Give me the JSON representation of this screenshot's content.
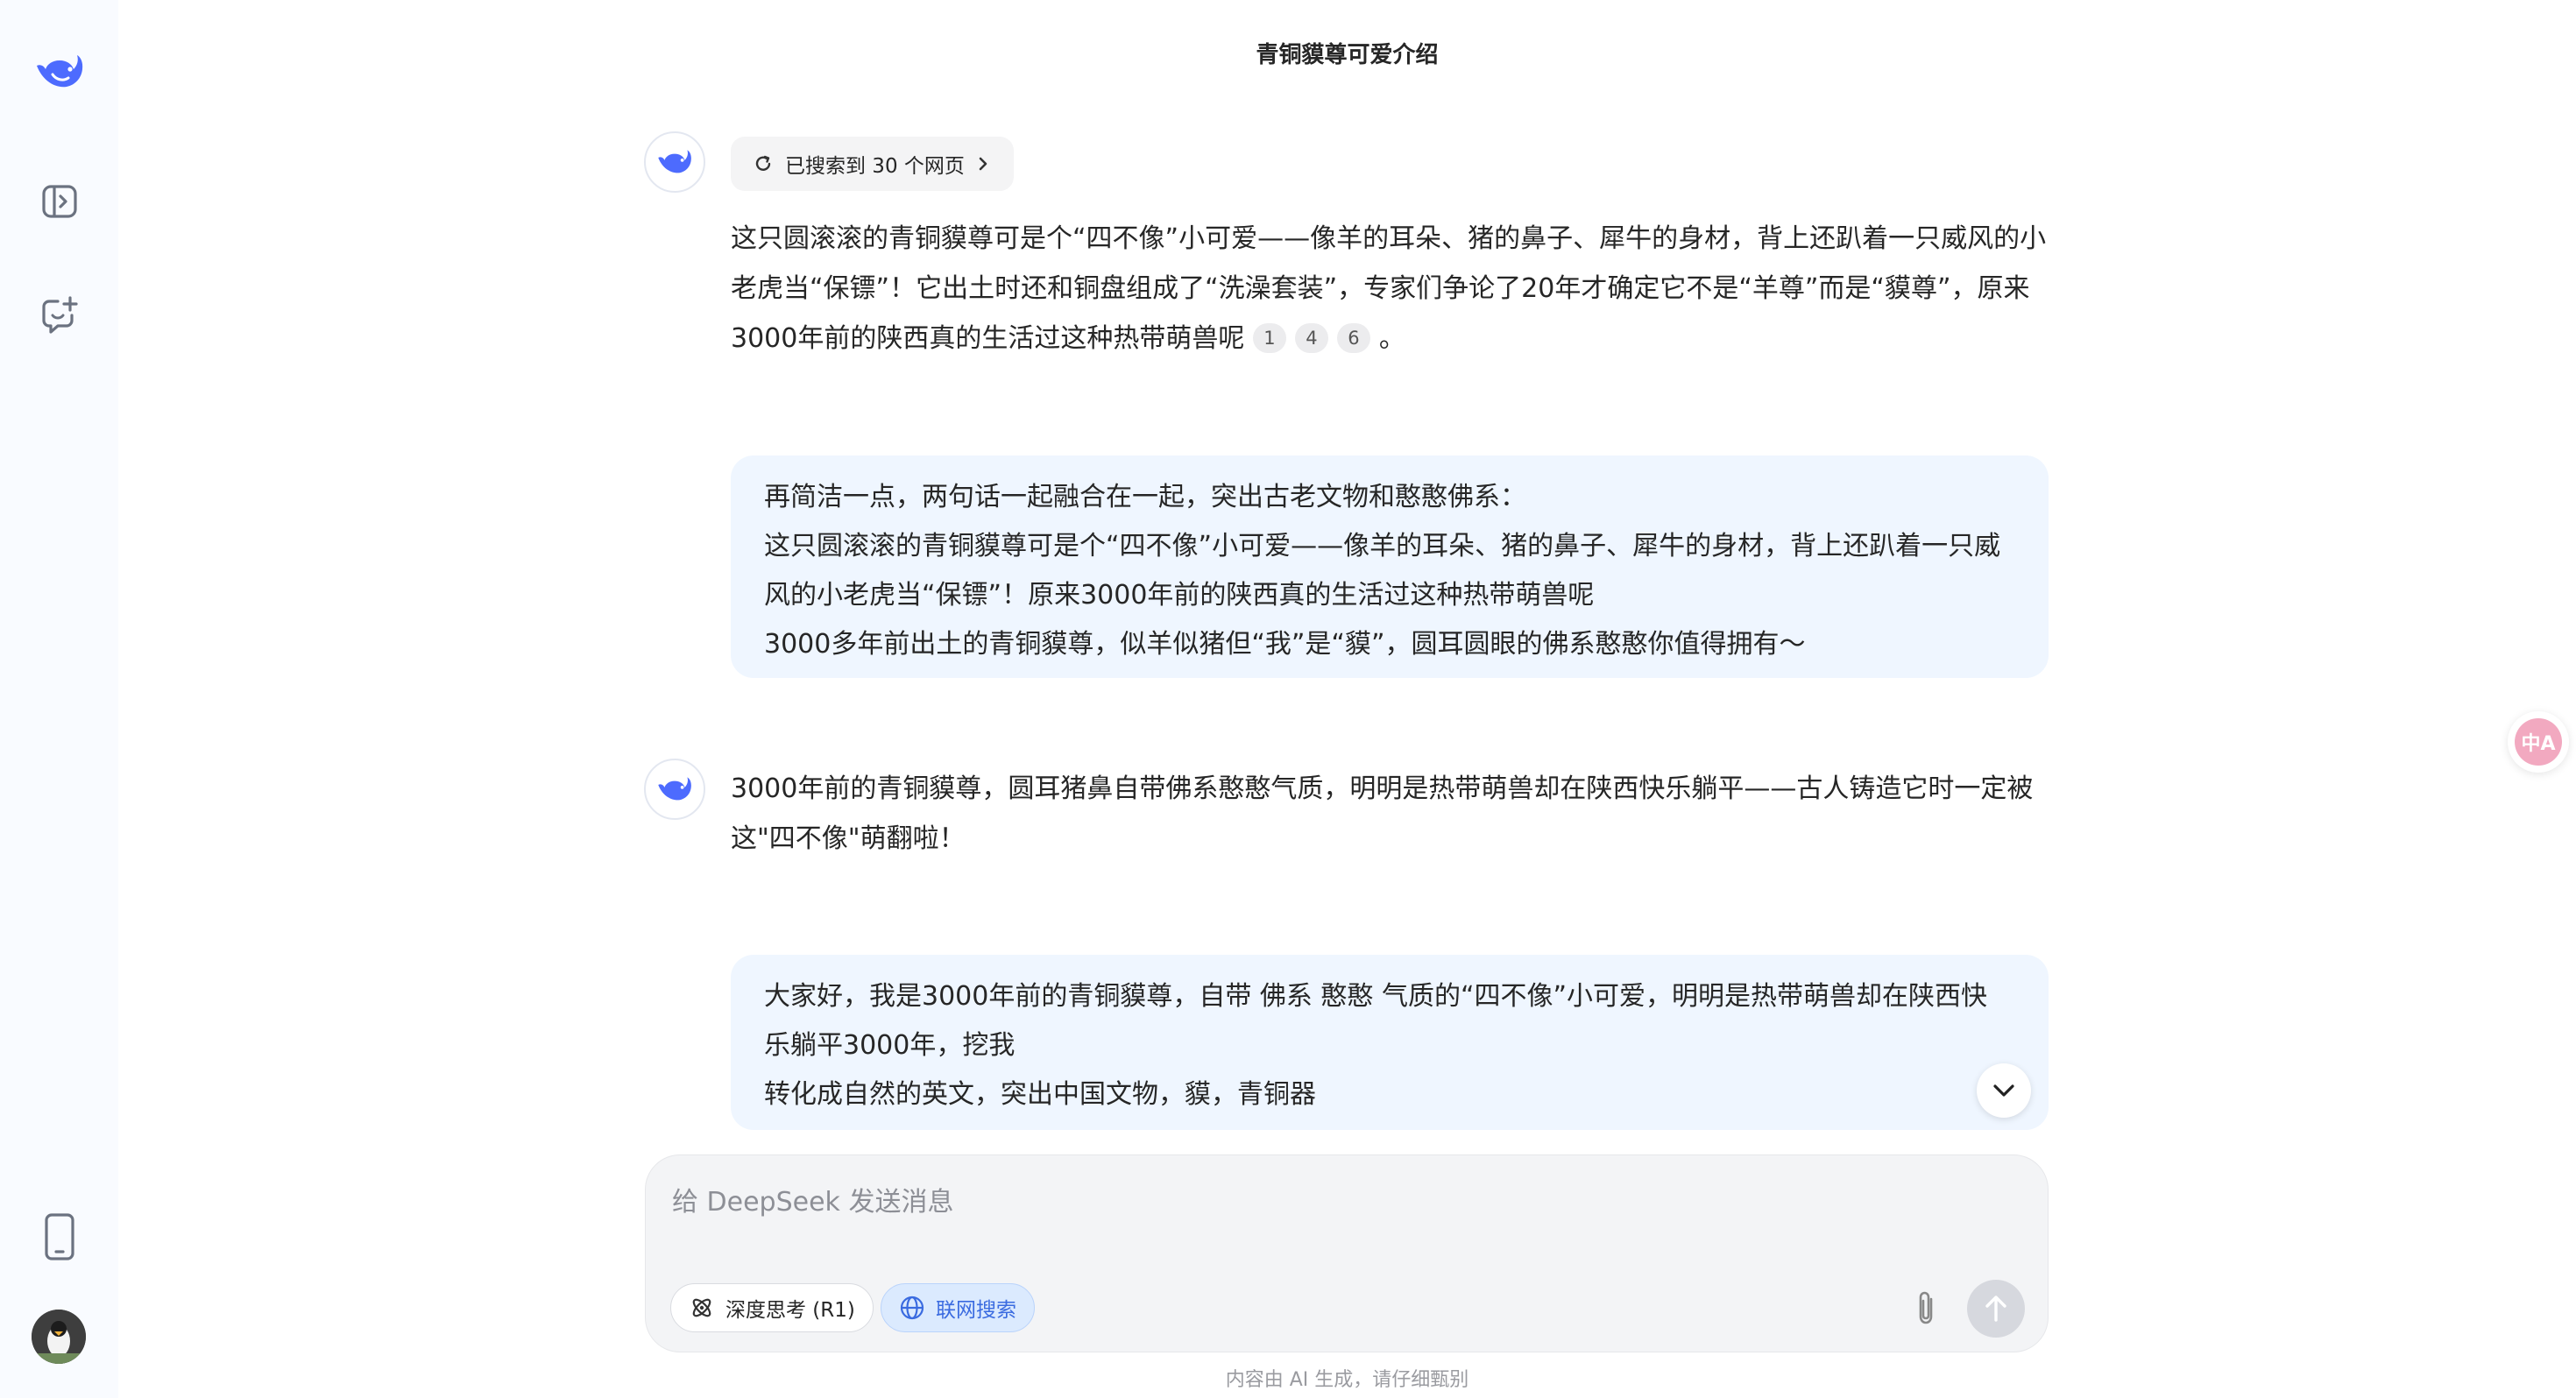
{
  "header": {
    "title": "青铜貘尊可爱介绍"
  },
  "search": {
    "label": "已搜索到 30 个网页"
  },
  "messages": {
    "a1": {
      "line1": "这只圆滚滚的青铜貘尊可是个“四不像”小可爱——像羊的耳朵、猪的鼻子、犀牛的身材，背上还趴着一只威风的小",
      "line2": "老虎当“保镖”！它出土时还和铜盘组成了“洗澡套装”，专家们争论了20年才确定它不是“羊尊”而是“貘尊”，原来",
      "line3": "3000年前的陕西真的生活过这种热带萌兽呢",
      "citations": [
        "1",
        "4",
        "6"
      ],
      "end": "。"
    },
    "u1": {
      "line1": "再简洁一点，两句话一起融合在一起，突出古老文物和憨憨佛系：",
      "line2": "这只圆滚滚的青铜貘尊可是个“四不像”小可爱——像羊的耳朵、猪的鼻子、犀牛的身材，背上还趴着一只威",
      "line3": "风的小老虎当“保镖”！原来3000年前的陕西真的生活过这种热带萌兽呢",
      "line4": "3000多年前出土的青铜貘尊，似羊似猪但“我”是“貘”，圆耳圆眼的佛系憨憨你值得拥有～"
    },
    "a2": {
      "line1": "3000年前的青铜貘尊，圆耳猪鼻自带佛系憨憨气质，明明是热带萌兽却在陕西快乐躺平——古人铸造它时一定被",
      "line2": "这\"四不像\"萌翻啦！"
    },
    "u2": {
      "line1": "大家好，我是3000年前的青铜貘尊，自带 佛系 憨憨 气质的“四不像”小可爱，明明是热带萌兽却在陕西快",
      "line2": "乐躺平3000年，挖我",
      "line3": "转化成自然的英文，突出中国文物，貘，青铜器"
    }
  },
  "composer": {
    "placeholder": "给 DeepSeek 发送消息",
    "deep_think": "深度思考 (R1)",
    "web_search": "联网搜索"
  },
  "disclaimer": "内容由 AI 生成，请仔细甄别",
  "translate_badge": "中A",
  "colors": {
    "brand": "#4d6bfe",
    "sidebar_bg": "#f9fbff",
    "user_bubble": "#eff6ff",
    "web_pill": "#dbeafe"
  }
}
